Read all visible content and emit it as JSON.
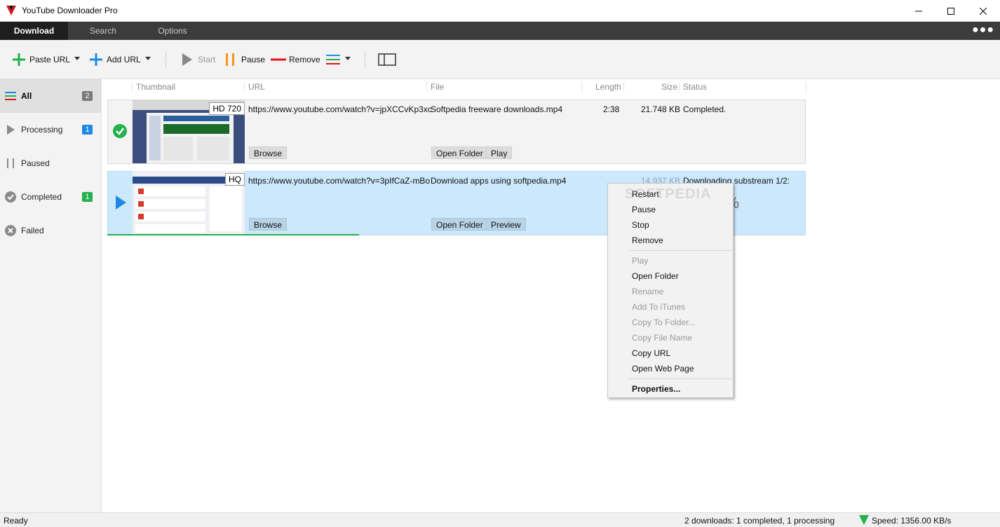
{
  "window": {
    "title": "YouTube Downloader Pro"
  },
  "tabs": [
    {
      "label": "Download",
      "active": true
    },
    {
      "label": "Search",
      "active": false
    },
    {
      "label": "Options",
      "active": false
    }
  ],
  "toolbar": {
    "paste_url": "Paste URL",
    "add_url": "Add URL",
    "start": "Start",
    "pause": "Pause",
    "remove": "Remove"
  },
  "sidebar": {
    "items": [
      {
        "label": "All",
        "count": "2",
        "badge_color": "#7a7a7a",
        "active": true,
        "icon": "list-icon"
      },
      {
        "label": "Processing",
        "count": "1",
        "badge_color": "#1e88e5",
        "icon": "play-icon"
      },
      {
        "label": "Paused",
        "count": "",
        "icon": "pause-icon"
      },
      {
        "label": "Completed",
        "count": "1",
        "badge_color": "#22b14c",
        "icon": "check-icon"
      },
      {
        "label": "Failed",
        "count": "",
        "icon": "x-circle-icon"
      }
    ]
  },
  "columns": [
    "Thumbnail",
    "URL",
    "File",
    "Length",
    "Size",
    "Status"
  ],
  "downloads": [
    {
      "quality": "HD 720",
      "url": "https://www.youtube.com/watch?v=jpXCCvKp3xc",
      "file": "Softpedia freeware downloads.mp4",
      "length": "2:38",
      "size": "21.748 KB",
      "status": "Completed.",
      "buttons": [
        "Browse",
        "Open Folder",
        "Play"
      ],
      "state_icon": "check-icon"
    },
    {
      "quality": "HQ",
      "url": "https://www.youtube.com/watch?v=3pIfCaZ-mBo",
      "file": "Download apps using softpedia.mp4",
      "length": "",
      "size": "14.937 KB",
      "status": "Downloading substream 1/2:",
      "percent_text": "36%",
      "progress": 0.36,
      "buttons": [
        "Browse",
        "Open Folder",
        "Preview"
      ],
      "state_icon": "play-icon"
    }
  ],
  "context_menu": {
    "items": [
      {
        "label": "Restart",
        "enabled": true
      },
      {
        "label": "Pause",
        "enabled": true
      },
      {
        "label": "Stop",
        "enabled": true
      },
      {
        "label": "Remove",
        "enabled": true
      },
      {
        "label": "Play",
        "enabled": false
      },
      {
        "label": "Open Folder",
        "enabled": true
      },
      {
        "label": "Rename",
        "enabled": false
      },
      {
        "label": "Add To iTunes",
        "enabled": false
      },
      {
        "label": "Copy To Folder...",
        "enabled": false
      },
      {
        "label": "Copy File Name",
        "enabled": false
      },
      {
        "label": "Copy URL",
        "enabled": true
      },
      {
        "label": "Open Web Page",
        "enabled": true
      },
      {
        "label": "Properties...",
        "enabled": true,
        "bold": true
      }
    ]
  },
  "watermark": "SOFTPEDIA",
  "status": {
    "left": "Ready",
    "summary": "2 downloads: 1 completed, 1 processing",
    "speed": "Speed: 1356.00 KB/s"
  },
  "colors": {
    "accent_blue": "#1e88e5",
    "green": "#22b14c",
    "selected_row": "#cce8fb",
    "tabstrip": "#3c3c3c"
  }
}
